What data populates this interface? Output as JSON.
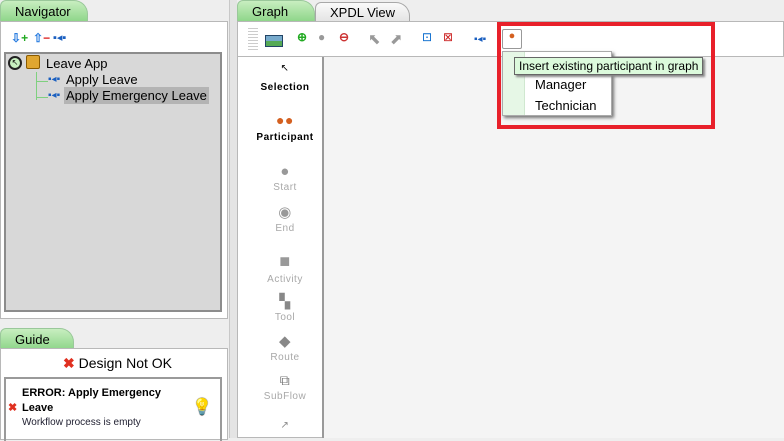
{
  "navigator": {
    "tab_label": "Navigator",
    "tree": {
      "root": "Leave App",
      "children": [
        "Apply Leave",
        "Apply Emergency Leave"
      ],
      "selected": "Apply Emergency Leave"
    }
  },
  "guide": {
    "tab_label": "Guide",
    "status": "Design Not OK",
    "error_title": "ERROR: Apply Emergency Leave",
    "error_message": "Workflow process is empty"
  },
  "editor": {
    "tabs": [
      {
        "label": "Graph",
        "active": true
      },
      {
        "label": "XPDL View",
        "active": false
      }
    ]
  },
  "palette": [
    "Selection",
    "Participant",
    "Start",
    "End",
    "Activity",
    "Tool",
    "Route",
    "SubFlow"
  ],
  "participant_menu": {
    "tooltip": "Insert existing participant in graph",
    "items": [
      "Manager",
      "Technician"
    ]
  },
  "colors": {
    "tab_active": "#8fd68a",
    "highlight_box": "#e8202a",
    "tooltip_bg": "#dcfadc"
  }
}
